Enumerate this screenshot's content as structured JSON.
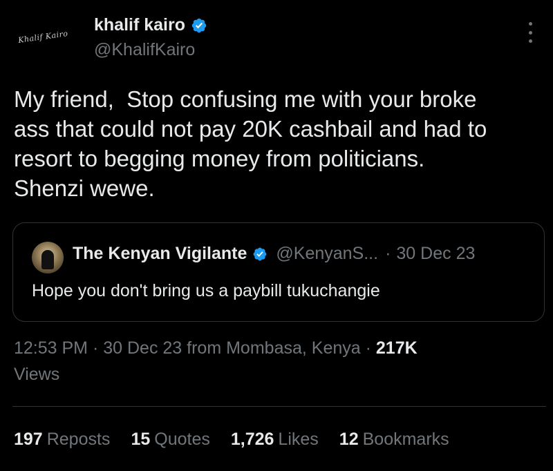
{
  "author": {
    "name": "khalif kairo",
    "handle": "@KhalifKairo",
    "avatar_logo_text": "Khalif Kairo",
    "verified": true
  },
  "tweet": {
    "text": "My friend,  Stop confusing me with your broke\nass that could not pay 20K cashbail and had to\nresort to begging money from politicians.\nShenzi wewe."
  },
  "quote": {
    "name": "The Kenyan Vigilante",
    "handle": "@KenyanS...",
    "separator": "·",
    "date": "30 Dec 23",
    "text": "Hope you don't bring us a paybill tukuchangie",
    "verified": true
  },
  "meta": {
    "time": "12:53 PM",
    "sep1": "·",
    "date_location": "30 Dec 23 from Mombasa, Kenya",
    "sep2": "·",
    "views_count": "217K",
    "views_label": "Views"
  },
  "stats": [
    {
      "count": "197",
      "label": "Reposts"
    },
    {
      "count": "15",
      "label": "Quotes"
    },
    {
      "count": "1,726",
      "label": "Likes"
    },
    {
      "count": "12",
      "label": "Bookmarks"
    }
  ],
  "icons": {
    "verified": "verified-badge-icon",
    "more": "more-vertical-icon"
  },
  "colors": {
    "background": "#000000",
    "text_primary": "#e7e9ea",
    "text_secondary": "#71767b",
    "verified_blue": "#1d9bf0",
    "border": "#2f3336"
  }
}
